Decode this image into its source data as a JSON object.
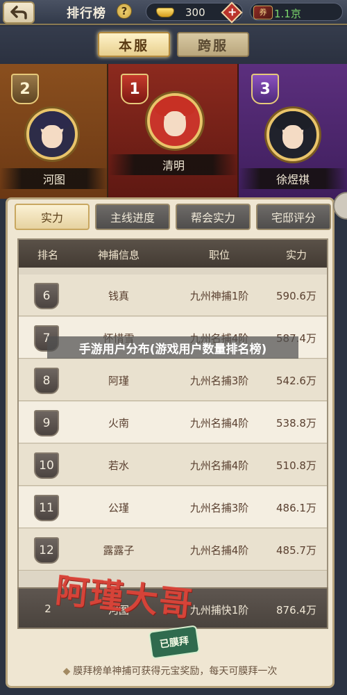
{
  "header": {
    "title": "排行榜",
    "help_label": "?",
    "ingot_value": "300",
    "jade_value": "1.1京",
    "plus_label": "+",
    "jade_icon_label": "券"
  },
  "server_tabs": [
    {
      "label": "本服",
      "active": true
    },
    {
      "label": "跨服",
      "active": false
    }
  ],
  "top3": [
    {
      "rank": "2",
      "name": "河图"
    },
    {
      "rank": "1",
      "name": "清明"
    },
    {
      "rank": "3",
      "name": "徐煜祺"
    }
  ],
  "category_tabs": [
    {
      "label": "实力",
      "active": true
    },
    {
      "label": "主线进度",
      "active": false
    },
    {
      "label": "帮会实力",
      "active": false
    },
    {
      "label": "宅邸评分",
      "active": false
    }
  ],
  "table": {
    "headers": [
      "排名",
      "神捕信息",
      "职位",
      "实力"
    ],
    "rows": [
      {
        "rank": "6",
        "name": "钱真",
        "position": "九州神捕1阶",
        "power": "590.6万"
      },
      {
        "rank": "7",
        "name": "怀惜雪",
        "position": "九州名捕4阶",
        "power": "587.4万"
      },
      {
        "rank": "8",
        "name": "阿瑾",
        "position": "九州名捕3阶",
        "power": "542.6万"
      },
      {
        "rank": "9",
        "name": "火南",
        "position": "九州名捕4阶",
        "power": "538.8万"
      },
      {
        "rank": "10",
        "name": "若水",
        "position": "九州名捕4阶",
        "power": "510.8万"
      },
      {
        "rank": "11",
        "name": "公瑾",
        "position": "九州名捕3阶",
        "power": "486.1万"
      },
      {
        "rank": "12",
        "name": "露露子",
        "position": "九州名捕4阶",
        "power": "485.7万"
      }
    ]
  },
  "my_rank": {
    "rank": "2",
    "name": "河图",
    "position": "九州捕快1阶",
    "power": "876.4万"
  },
  "footer_note": "膜拜榜单神捕可获得元宝奖励，每天可膜拜一次",
  "footer_diamond": "◆",
  "watermark": "手游用户分布(游戏用户数量排名榜)",
  "stamp": {
    "text": "阿瑾大哥",
    "badge": "已膜拜"
  },
  "colors": {
    "accent_gold": "#e9c46a",
    "jade_green": "#7bd66b",
    "stamp_red": "#dc463c"
  }
}
